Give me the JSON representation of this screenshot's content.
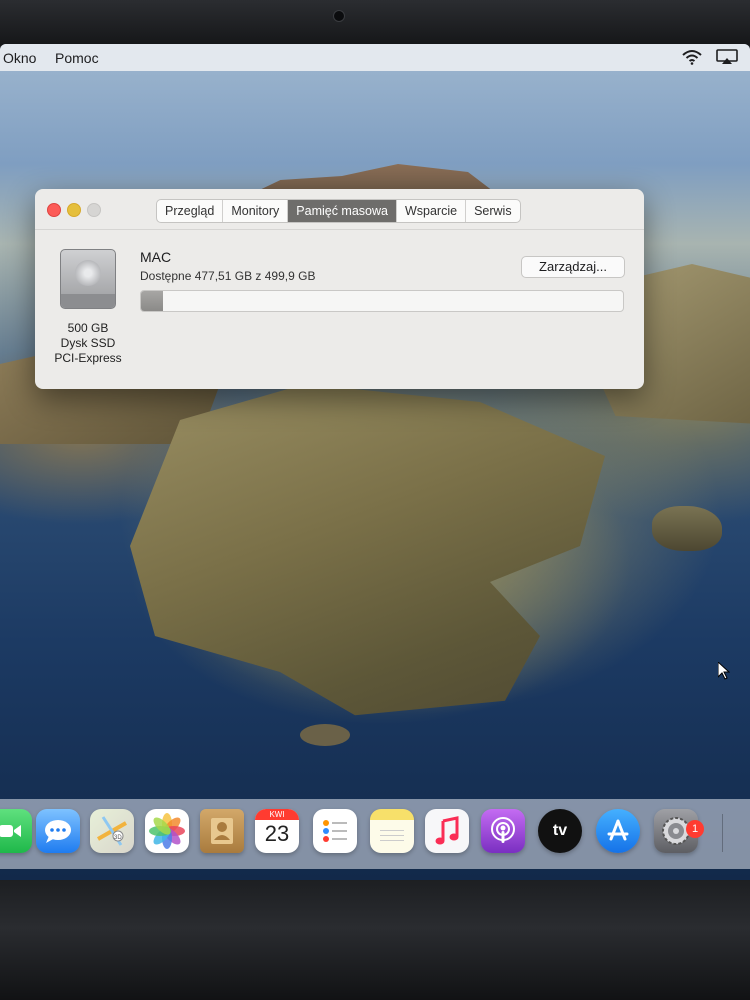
{
  "menubar": {
    "items": [
      "Okno",
      "Pomoc"
    ]
  },
  "window": {
    "tabs": [
      {
        "label": "Przegląd",
        "active": false
      },
      {
        "label": "Monitory",
        "active": false
      },
      {
        "label": "Pamięć masowa",
        "active": true
      },
      {
        "label": "Wsparcie",
        "active": false
      },
      {
        "label": "Serwis",
        "active": false
      }
    ],
    "disk": {
      "size": "500 GB",
      "type": "Dysk SSD",
      "interface": "PCI-Express"
    },
    "volume": {
      "name": "MAC",
      "available": "Dostępne 477,51 GB z 499,9 GB",
      "used_fraction": 0.045
    },
    "manage_label": "Zarządzaj..."
  },
  "dock": {
    "items": [
      {
        "name": "facetime-icon",
        "color": "#34c759"
      },
      {
        "name": "messages-icon",
        "color": "#2f8cff"
      },
      {
        "name": "maps-icon",
        "color": "#e9e6db"
      },
      {
        "name": "photos-icon",
        "color": "#ffffff"
      },
      {
        "name": "contacts-icon",
        "color": "#c89a59"
      },
      {
        "name": "calendar-icon",
        "color": "#ffffff",
        "month": "KWI",
        "day": "23"
      },
      {
        "name": "reminders-icon",
        "color": "#ffffff"
      },
      {
        "name": "notes-icon",
        "color": "#f7e57a"
      },
      {
        "name": "music-icon",
        "color": "#f4f4f6"
      },
      {
        "name": "podcasts-icon",
        "color": "#9b46d9"
      },
      {
        "name": "apple-tv-icon",
        "color": "#111111",
        "label": "tv"
      },
      {
        "name": "app-store-icon",
        "color": "#1f8df4"
      },
      {
        "name": "system-preferences-icon",
        "color": "#8e8e93",
        "badge": "1"
      }
    ]
  }
}
